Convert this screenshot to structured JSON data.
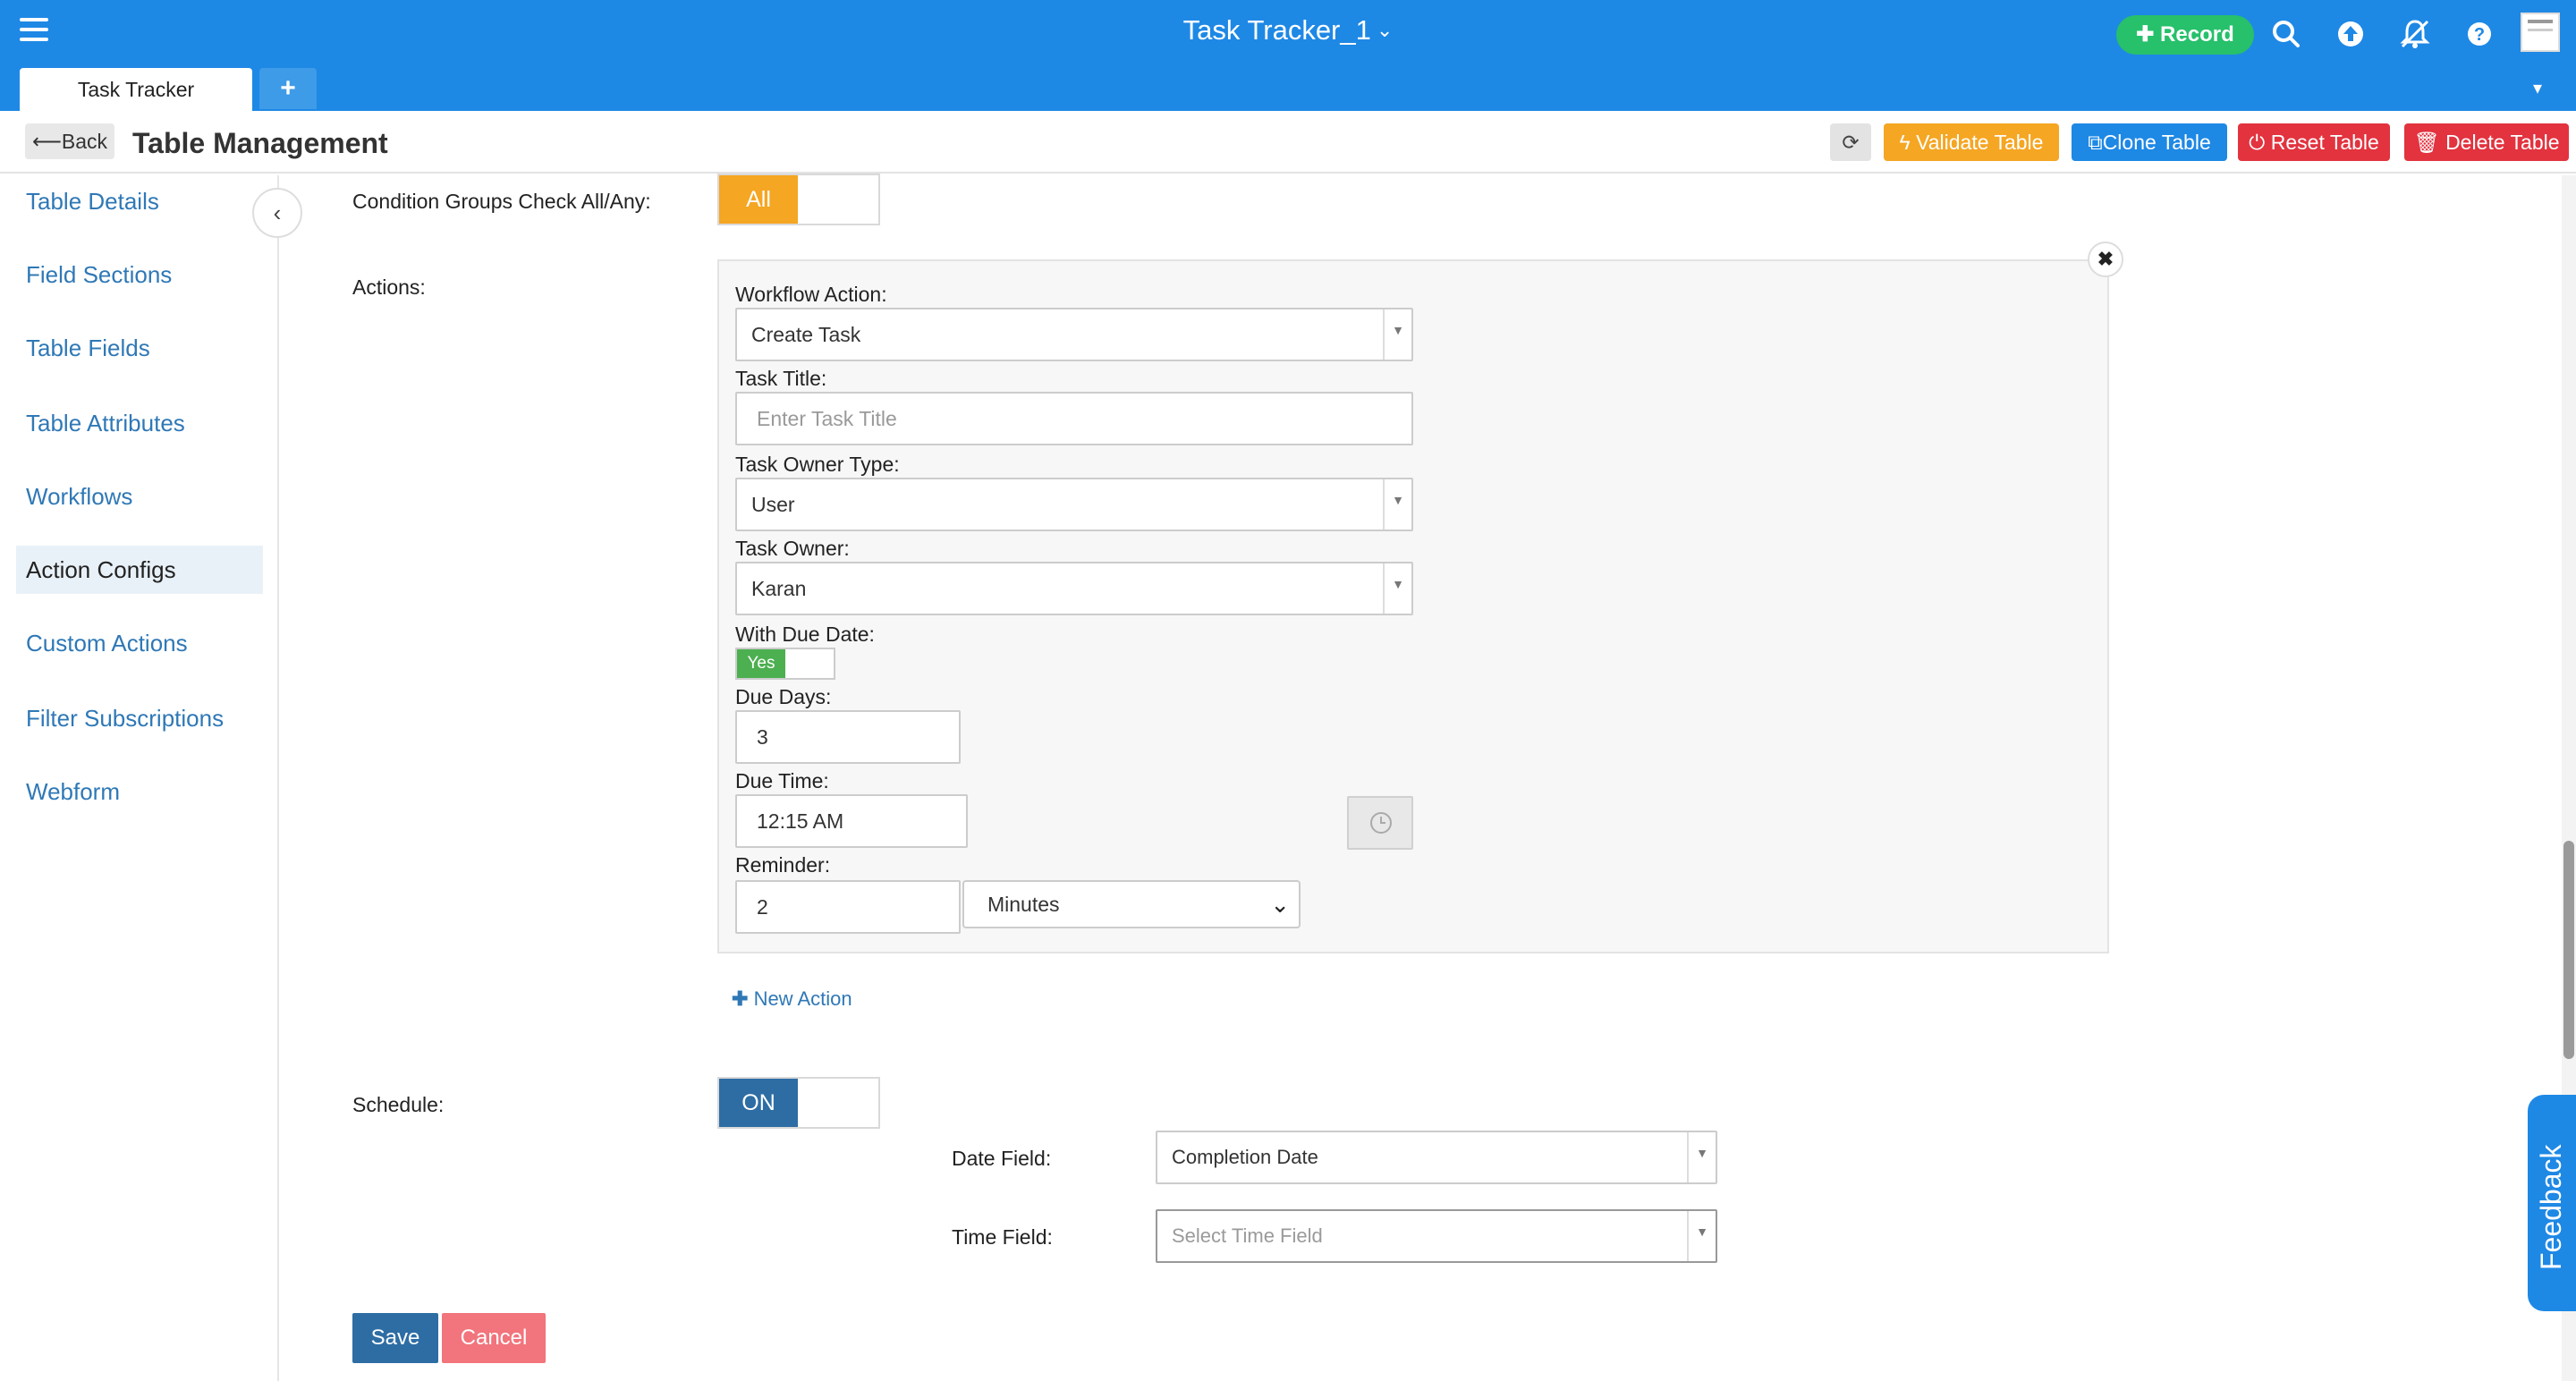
{
  "topbar": {
    "title": "Task Tracker_1",
    "record_label": "Record",
    "tabs": [
      {
        "label": "Task Tracker"
      }
    ],
    "icons": [
      "menu-icon",
      "search-icon",
      "upload-icon",
      "notifications-off-icon",
      "help-icon",
      "user-avatar"
    ]
  },
  "subheader": {
    "back_label": "Back",
    "page_title": "Table Management",
    "validate_label": "Validate Table",
    "clone_label": "Clone Table",
    "reset_label": "Reset Table",
    "delete_label": "Delete Table"
  },
  "sidebar": {
    "items": [
      {
        "label": "Table Details"
      },
      {
        "label": "Field Sections"
      },
      {
        "label": "Table Fields"
      },
      {
        "label": "Table Attributes"
      },
      {
        "label": "Workflows"
      },
      {
        "label": "Action Configs",
        "active": true
      },
      {
        "label": "Custom Actions"
      },
      {
        "label": "Filter Subscriptions"
      },
      {
        "label": "Webform"
      }
    ]
  },
  "form": {
    "condition_groups_label": "Condition Groups Check All/Any:",
    "condition_groups_value": "All",
    "actions_label": "Actions:",
    "workflow_action_label": "Workflow Action:",
    "workflow_action_value": "Create Task",
    "task_title_label": "Task Title:",
    "task_title_placeholder": "Enter Task Title",
    "task_owner_type_label": "Task Owner Type:",
    "task_owner_type_value": "User",
    "task_owner_label": "Task Owner:",
    "task_owner_value": "Karan",
    "with_due_date_label": "With Due Date:",
    "with_due_date_value": "Yes",
    "due_days_label": "Due Days:",
    "due_days_value": "3",
    "due_time_label": "Due Time:",
    "due_time_value": "12:15 AM",
    "reminder_label": "Reminder:",
    "reminder_value": "2",
    "reminder_unit": "Minutes",
    "new_action_label": "New Action",
    "schedule_label": "Schedule:",
    "schedule_value": "ON",
    "date_field_label": "Date Field:",
    "date_field_value": "Completion Date",
    "time_field_label": "Time Field:",
    "time_field_placeholder": "Select Time Field",
    "save_label": "Save",
    "cancel_label": "Cancel"
  },
  "feedback_label": "Feedback",
  "colors": {
    "primary": "#1e88e5",
    "record": "#27c06b",
    "validate": "#f5a623",
    "danger": "#e2333f",
    "toggle_all": "#f5a623",
    "toggle_on": "#2e6da4",
    "toggle_yes": "#4caf50"
  }
}
